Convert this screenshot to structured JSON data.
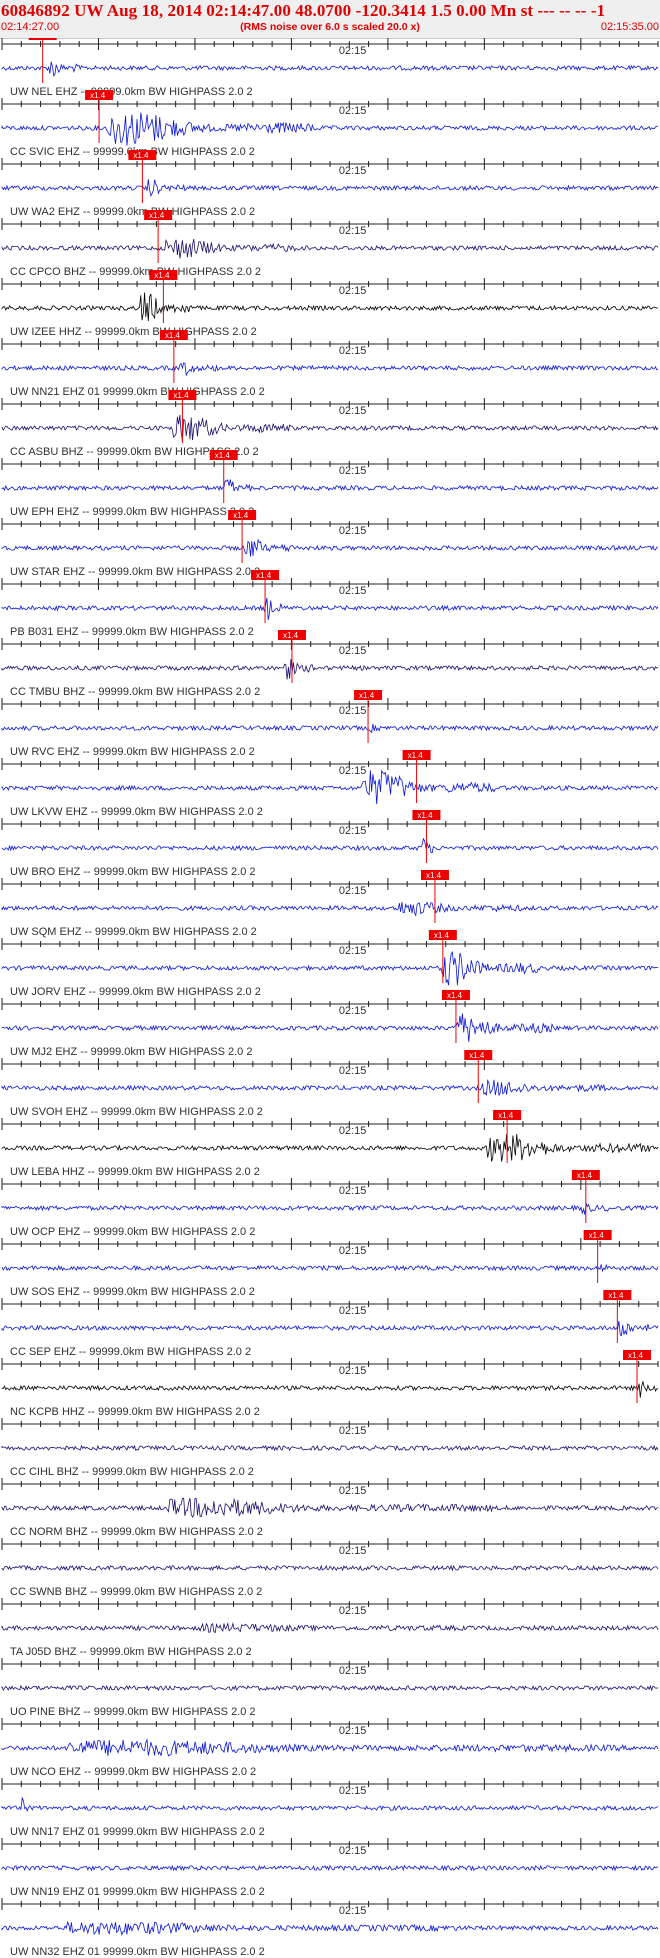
{
  "header": {
    "title": "60846892 UW Aug 18, 2014 02:14:47.00   48.0700 -120.3414  1.5 0.00 Mn st --- -- --  -1",
    "subtitle": "(RMS noise over 6.0 s scaled 20.0 x)",
    "time_start": "02:14:27.00",
    "time_end": "02:15:35.00"
  },
  "minute_mark_label": "02:15",
  "pick_label": "x1.4",
  "colors": {
    "header_text": "#e00000",
    "pick": "#ee0000",
    "trace_blue": "#0b16d8",
    "trace_navy": "#1d0f6e",
    "trace_black": "#000000"
  },
  "traces": [
    {
      "label": "UW NEL EHZ -- 99999.0km BW  HIGHPASS  2.0  2",
      "color": "trace_blue",
      "pick": 0.062,
      "onset": 0.07,
      "amp": 0.55,
      "dur": 0.05
    },
    {
      "label": "CC SVIC EHZ -- 99999.0km BW  HIGHPASS  2.0  2",
      "color": "trace_blue",
      "pick": 0.148,
      "onset": 0.16,
      "amp": 1.0,
      "dur": 0.32
    },
    {
      "label": "UW WA2 EHZ -- 99999.0km BW  HIGHPASS  2.0  2",
      "color": "trace_blue",
      "pick": 0.214,
      "onset": 0.22,
      "amp": 0.45,
      "dur": 0.06
    },
    {
      "label": "CC CPCO BHZ -- 99999.0km BW  HIGHPASS  2.0  2",
      "color": "trace_navy",
      "pick": 0.238,
      "onset": 0.25,
      "amp": 0.55,
      "dur": 0.2
    },
    {
      "label": "UW IZEE HHZ -- 99999.0km BW  HIGHPASS  2.0  2",
      "color": "trace_black",
      "pick": 0.246,
      "onset": 0.21,
      "amp": 0.95,
      "dur": 0.08
    },
    {
      "label": "UW NN21 EHZ 01 99999.0km BW  HIGHPASS  2.0  2",
      "color": "trace_blue",
      "pick": 0.262,
      "onset": 0.27,
      "amp": 0.35,
      "dur": 0.06
    },
    {
      "label": "CC ASBU BHZ -- 99999.0km BW  HIGHPASS  2.0  2",
      "color": "trace_navy",
      "pick": 0.275,
      "onset": 0.26,
      "amp": 0.75,
      "dur": 0.18
    },
    {
      "label": "UW EPH EHZ -- 99999.0km BW  HIGHPASS  2.0  2",
      "color": "trace_blue",
      "pick": 0.338,
      "onset": 0.34,
      "amp": 0.55,
      "dur": 0.04
    },
    {
      "label": "UW STAR EHZ -- 99999.0km BW  HIGHPASS  2.0  2",
      "color": "trace_blue",
      "pick": 0.366,
      "onset": 0.37,
      "amp": 0.55,
      "dur": 0.08
    },
    {
      "label": "PB B031 EHZ -- 99999.0km BW  HIGHPASS  2.0  2",
      "color": "trace_blue",
      "pick": 0.401,
      "onset": 0.4,
      "amp": 0.8,
      "dur": 0.03
    },
    {
      "label": "CC TMBU BHZ -- 99999.0km BW  HIGHPASS  2.0  2",
      "color": "trace_navy",
      "pick": 0.442,
      "onset": 0.43,
      "amp": 0.6,
      "dur": 0.05
    },
    {
      "label": "UW RVC EHZ -- 99999.0km BW  HIGHPASS  2.0  2",
      "color": "trace_blue",
      "pick": 0.558,
      "onset": 0.56,
      "amp": 0.2,
      "dur": 0.02
    },
    {
      "label": "UW LKVW EHZ -- 99999.0km BW  HIGHPASS  2.0  2",
      "color": "trace_blue",
      "pick": 0.632,
      "onset": 0.55,
      "amp": 1.0,
      "dur": 0.2
    },
    {
      "label": "UW BRO EHZ -- 99999.0km BW  HIGHPASS  2.0  2",
      "color": "trace_blue",
      "pick": 0.647,
      "onset": 0.64,
      "amp": 0.9,
      "dur": 0.02
    },
    {
      "label": "UW SQM EHZ -- 99999.0km BW  HIGHPASS  2.0  2",
      "color": "trace_blue",
      "pick": 0.66,
      "onset": 0.6,
      "amp": 0.35,
      "dur": 0.2
    },
    {
      "label": "UW JORV EHZ -- 99999.0km BW  HIGHPASS  2.0  2",
      "color": "trace_blue",
      "pick": 0.672,
      "onset": 0.67,
      "amp": 1.0,
      "dur": 0.15
    },
    {
      "label": "UW MJ2 EHZ -- 99999.0km BW  HIGHPASS  2.0  2",
      "color": "trace_blue",
      "pick": 0.692,
      "onset": 0.69,
      "amp": 0.8,
      "dur": 0.15
    },
    {
      "label": "UW SVOH EHZ -- 99999.0km BW  HIGHPASS  2.0  2",
      "color": "trace_blue",
      "pick": 0.726,
      "onset": 0.73,
      "amp": 0.4,
      "dur": 0.2
    },
    {
      "label": "UW LEBA HHZ -- 99999.0km BW  HIGHPASS  2.0  2",
      "color": "trace_black",
      "pick": 0.77,
      "onset": 0.74,
      "amp": 0.8,
      "dur": 0.25
    },
    {
      "label": "UW OCP EHZ -- 99999.0km BW  HIGHPASS  2.0  2",
      "color": "trace_blue",
      "pick": 0.89,
      "onset": 0.88,
      "amp": 0.3,
      "dur": 0.05
    },
    {
      "label": "UW SOS EHZ -- 99999.0km BW  HIGHPASS  2.0  2",
      "color": "trace_blue",
      "pick": 0.908,
      "onset": 0.91,
      "amp": 0.2,
      "dur": 0.03
    },
    {
      "label": "CC SEP EHZ -- 99999.0km BW  HIGHPASS  2.0  2",
      "color": "trace_blue",
      "pick": 0.938,
      "onset": 0.94,
      "amp": 0.6,
      "dur": 0.05
    },
    {
      "label": "NC KCPB HHZ -- 99999.0km BW  HIGHPASS  2.0  2",
      "color": "trace_black",
      "pick": 0.968,
      "onset": 0.97,
      "amp": 0.5,
      "dur": 0.03
    },
    {
      "label": "CC CIHL BHZ -- 99999.0km BW  HIGHPASS  2.0  2",
      "color": "trace_navy",
      "pick": null,
      "onset": 0.0,
      "amp": 0.0,
      "dur": 0.0
    },
    {
      "label": "CC NORM BHZ -- 99999.0km BW  HIGHPASS  2.0  2",
      "color": "trace_navy",
      "pick": null,
      "onset": 0.25,
      "amp": 0.5,
      "dur": 0.5
    },
    {
      "label": "CC SWNB BHZ -- 99999.0km BW  HIGHPASS  2.0  2",
      "color": "trace_navy",
      "pick": null,
      "onset": 0.0,
      "amp": 0.0,
      "dur": 0.0
    },
    {
      "label": "TA J05D BHZ -- 99999.0km BW  HIGHPASS  2.0  2",
      "color": "trace_navy",
      "pick": null,
      "onset": 0.3,
      "amp": 0.15,
      "dur": 0.4
    },
    {
      "label": "UO PINE BHZ -- 99999.0km BW  HIGHPASS  2.0  2",
      "color": "trace_navy",
      "pick": null,
      "onset": 0.0,
      "amp": 0.0,
      "dur": 0.0
    },
    {
      "label": "UW NCO EHZ -- 99999.0km BW  HIGHPASS  2.0  2",
      "color": "trace_blue",
      "pick": null,
      "onset": 0.1,
      "amp": 0.4,
      "dur": 0.85
    },
    {
      "label": "UW NN17 EHZ 01 99999.0km BW  HIGHPASS  2.0  2",
      "color": "trace_blue",
      "pick": null,
      "onset": 0.03,
      "amp": 0.5,
      "dur": 0.01
    },
    {
      "label": "UW NN19 EHZ 01 99999.0km BW  HIGHPASS  2.0  2",
      "color": "trace_blue",
      "pick": null,
      "onset": 0.0,
      "amp": 0.0,
      "dur": 0.0
    },
    {
      "label": "UW NN32 EHZ 01 99999.0km BW  HIGHPASS  2.0  2",
      "color": "trace_blue",
      "pick": null,
      "onset": 0.1,
      "amp": 0.3,
      "dur": 0.6
    }
  ]
}
